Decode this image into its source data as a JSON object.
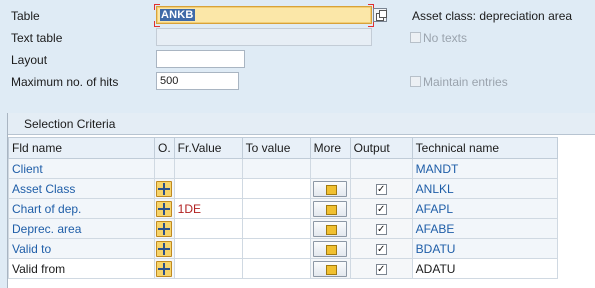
{
  "form": {
    "table_label": "Table",
    "table_value": "ANKB",
    "text_table_label": "Text table",
    "text_table_value": "",
    "layout_label": "Layout",
    "layout_value": "",
    "max_hits_label": "Maximum no. of hits",
    "max_hits_value": "500",
    "table_description": "Asset class: depreciation area",
    "no_texts_label": "No texts",
    "no_texts_checked": false,
    "maintain_entries_label": "Maintain entries",
    "maintain_entries_checked": false
  },
  "selection_criteria": {
    "title": "Selection Criteria",
    "columns": [
      "Fld name",
      "O.",
      "Fr.Value",
      "To value",
      "More",
      "Output",
      "Technical name"
    ],
    "rows": [
      {
        "field": "Client",
        "from": "",
        "to": "",
        "output": null,
        "technical": "MANDT",
        "has_controls": false
      },
      {
        "field": "Asset Class",
        "from": "",
        "to": "",
        "output": true,
        "technical": "ANLKL",
        "has_controls": true
      },
      {
        "field": "Chart of dep.",
        "from": "1DE",
        "to": "",
        "output": true,
        "technical": "AFAPL",
        "has_controls": true
      },
      {
        "field": "Deprec. area",
        "from": "",
        "to": "",
        "output": true,
        "technical": "AFABE",
        "has_controls": true
      },
      {
        "field": "Valid to",
        "from": "",
        "to": "",
        "output": true,
        "technical": "BDATU",
        "has_controls": true
      },
      {
        "field": "Valid from",
        "from": "",
        "to": "",
        "output": true,
        "technical": "ADATU",
        "has_controls": true
      }
    ]
  },
  "icons": {
    "value_help": "f4-multiple-selection-icon",
    "select_option": "select-option-icon",
    "more": "multiple-selection-arrow-icon"
  },
  "colors": {
    "background": "#dfebf5",
    "link_blue": "#1f5ea8",
    "focus_field": "#fbe7a8",
    "value_red": "#b22222"
  }
}
